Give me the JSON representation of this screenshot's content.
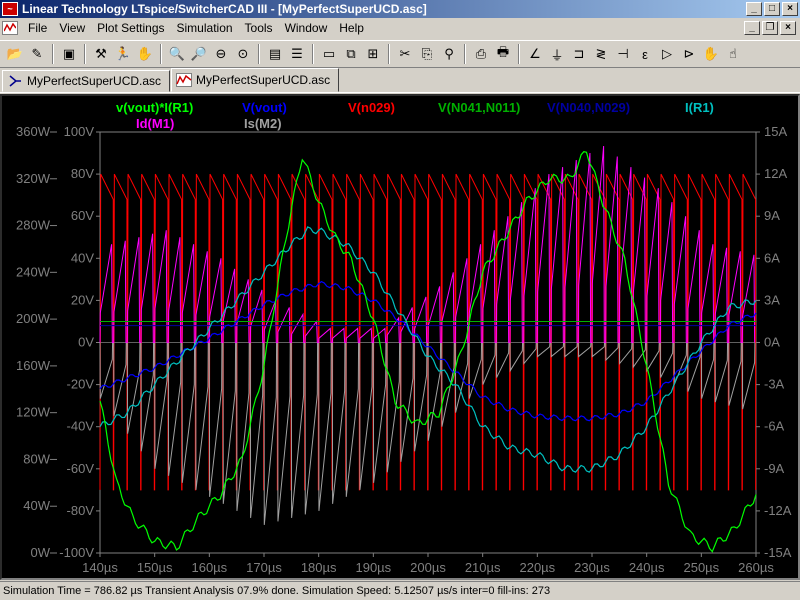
{
  "window": {
    "title": "Linear Technology LTspice/SwitcherCAD III - [MyPerfectSuperUCD.asc]"
  },
  "menu": {
    "items": [
      "File",
      "View",
      "Plot Settings",
      "Simulation",
      "Tools",
      "Window",
      "Help"
    ]
  },
  "tabs": [
    {
      "label": "MyPerfectSuperUCD.asc",
      "icon": "schematic-icon"
    },
    {
      "label": "MyPerfectSuperUCD.asc",
      "icon": "waveform-icon"
    }
  ],
  "toolbar": {
    "icons": [
      "open-icon",
      "new-schematic-icon",
      "save-icon",
      "control-panel-icon",
      "run-icon",
      "pan-icon",
      "zoom-in-icon",
      "zoom-out-icon",
      "zoom-fit-icon",
      "zoom-area-icon",
      "autorange-icon",
      "tile-horizontal-icon",
      "cascade-icon",
      "tile-vertical-icon",
      "cut-icon",
      "copy-icon",
      "find-icon",
      "print-preview-icon",
      "print-icon",
      "wire-icon",
      "ground-icon",
      "label-icon",
      "resistor-icon",
      "capacitor-icon",
      "inductor-icon",
      "diode-icon",
      "component-icon",
      "move-icon",
      "drag-icon"
    ]
  },
  "status": {
    "text": "Simulation Time = 786.82 µs  Transient Analysis 07.9% done. Simulation Speed: 5.12507 µs/s inter=0 fill-ins: 273"
  },
  "colors": {
    "background": "#000000",
    "v_vout_x_i_r1": "#00ff00",
    "v_vout": "#0000ff",
    "v_n029": "#ff0000",
    "v_n041_n011": "#00b000",
    "v_n040_n029": "#0000a0",
    "i_r1": "#00c0c0",
    "id_m1": "#ff00ff",
    "is_m2": "#a0a0a0"
  },
  "chart_data": {
    "type": "line",
    "title": "",
    "legend": [
      {
        "name": "v(vout)*I(R1)",
        "color": "#00ff00"
      },
      {
        "name": "V(vout)",
        "color": "#0000ff"
      },
      {
        "name": "V(n029)",
        "color": "#ff0000"
      },
      {
        "name": "V(N041,N011)",
        "color": "#00b000"
      },
      {
        "name": "V(N040,N029)",
        "color": "#0000a0"
      },
      {
        "name": "I(R1)",
        "color": "#00c0c0"
      },
      {
        "name": "Id(M1)",
        "color": "#ff00ff"
      },
      {
        "name": "Is(M2)",
        "color": "#a0a0a0"
      }
    ],
    "x_ticks": [
      "140µs",
      "150µs",
      "160µs",
      "170µs",
      "180µs",
      "190µs",
      "200µs",
      "210µs",
      "220µs",
      "230µs",
      "240µs",
      "250µs",
      "260µs"
    ],
    "xlim": [
      140,
      260
    ],
    "x_unit": "µs",
    "power_ticks": [
      "360W",
      "320W",
      "280W",
      "240W",
      "200W",
      "160W",
      "120W",
      "80W",
      "40W",
      "0W"
    ],
    "power_lim": [
      0,
      360
    ],
    "voltage_ticks": [
      "100V",
      "80V",
      "60V",
      "40V",
      "20V",
      "0V",
      "-20V",
      "-40V",
      "-60V",
      "-80V",
      "-100V"
    ],
    "voltage_lim": [
      -100,
      100
    ],
    "current_ticks": [
      "15A",
      "12A",
      "9A",
      "6A",
      "3A",
      "0A",
      "-3A",
      "-6A",
      "-9A",
      "-12A",
      "-15A"
    ],
    "current_lim": [
      -15,
      15
    ],
    "switching_period_us": 2.5,
    "series": [
      {
        "name": "V(vout)",
        "axis": "voltage",
        "x": [
          140,
          150,
          160,
          170,
          175,
          180,
          185,
          190,
          195,
          200,
          205,
          210,
          215,
          220,
          225,
          230,
          235,
          240,
          245,
          250,
          255,
          260
        ],
        "values": [
          -22,
          -12,
          2,
          18,
          24,
          28,
          26,
          20,
          10,
          -2,
          -14,
          -26,
          -32,
          -35,
          -36,
          -36,
          -34,
          -28,
          -16,
          -4,
          8,
          14
        ]
      },
      {
        "name": "I(R1)",
        "axis": "current",
        "x": [
          140,
          145,
          150,
          155,
          160,
          165,
          170,
          175,
          178,
          180,
          185,
          190,
          195,
          200,
          205,
          210,
          215,
          220,
          225,
          230,
          235,
          240,
          245,
          250,
          255,
          260
        ],
        "values": [
          -6,
          -5,
          -3,
          -1,
          1,
          3,
          5,
          7,
          8,
          8,
          7,
          5,
          2,
          -1,
          -3,
          -6,
          -7.5,
          -8,
          -9,
          -9,
          -8,
          -6,
          -3,
          0,
          2.5,
          3
        ]
      },
      {
        "name": "v(vout)*I(R1)",
        "axis": "power",
        "x": [
          140,
          143,
          146,
          150,
          154,
          158,
          162,
          166,
          170,
          174,
          177,
          180,
          183,
          186,
          190,
          194,
          198,
          202,
          206,
          210,
          214,
          218,
          222,
          226,
          229,
          232,
          236,
          240,
          244,
          248,
          252,
          256,
          260
        ],
        "values": [
          130,
          60,
          30,
          10,
          5,
          30,
          50,
          80,
          160,
          270,
          340,
          300,
          270,
          250,
          200,
          130,
          110,
          120,
          170,
          240,
          270,
          300,
          320,
          320,
          345,
          300,
          250,
          160,
          60,
          15,
          5,
          20,
          50
        ]
      },
      {
        "name": "V(N041,N011)",
        "axis": "voltage",
        "x": [
          140,
          260
        ],
        "values": [
          10,
          10
        ]
      },
      {
        "name": "V(N040,N029)",
        "axis": "voltage",
        "x": [
          140,
          260
        ],
        "values": [
          8,
          8
        ]
      },
      {
        "name": "V(n029)",
        "axis": "voltage",
        "pattern": "switching",
        "high": 80,
        "low": -70
      },
      {
        "name": "Id(M1)",
        "axis": "current",
        "pattern": "pulse",
        "x": [
          140,
          150,
          160,
          170,
          180,
          190,
          200,
          210,
          220,
          230,
          240,
          250,
          260
        ],
        "values": [
          7,
          8,
          6,
          3,
          1,
          1,
          4,
          8,
          12,
          14,
          11,
          7,
          6
        ]
      },
      {
        "name": "Is(M2)",
        "axis": "current",
        "pattern": "pulse",
        "x": [
          140,
          150,
          160,
          170,
          180,
          190,
          200,
          210,
          220,
          230,
          240,
          250,
          260
        ],
        "values": [
          -4,
          -9,
          -11,
          -13,
          -12,
          -10,
          -7,
          -3,
          -1,
          -1,
          -2,
          -4,
          -5
        ]
      }
    ]
  }
}
